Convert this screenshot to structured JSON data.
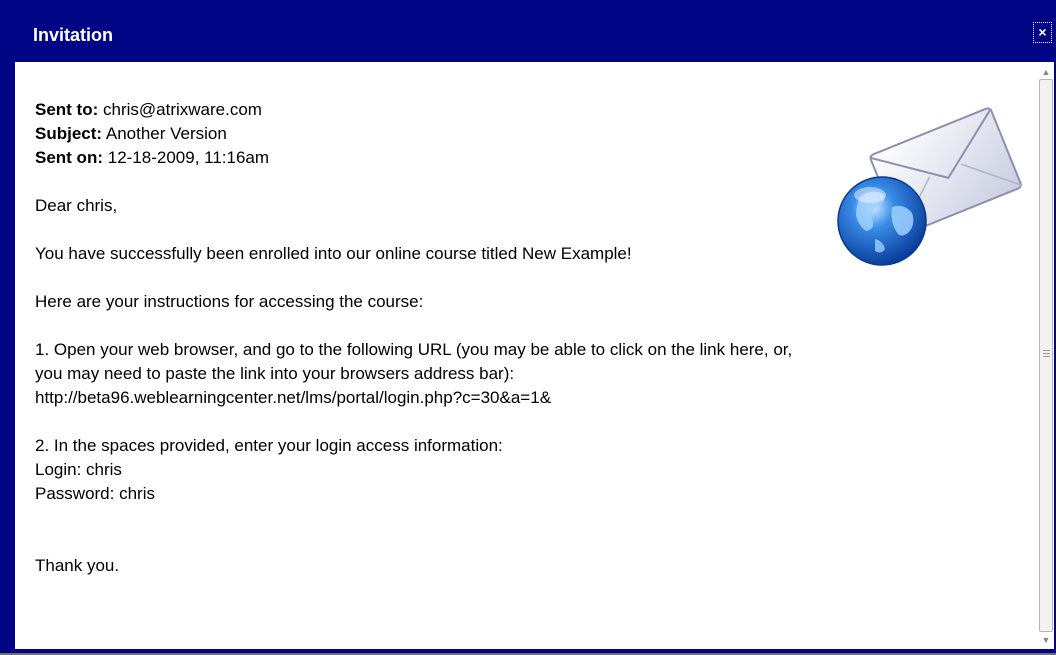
{
  "dialog": {
    "title": "Invitation",
    "close_label": "×"
  },
  "message": {
    "sent_to_label": "Sent to:",
    "sent_to": "chris@atrixware.com",
    "subject_label": "Subject:",
    "subject": "Another Version",
    "sent_on_label": "Sent on:",
    "sent_on": "12-18-2009, 11:16am",
    "greeting": "Dear chris,",
    "paragraph1": "You have successfully been enrolled into our online course titled New Example!",
    "paragraph2": "Here are your instructions for accessing the course:",
    "step1_line1": "1. Open your web browser, and go to the following URL (you may be able to click on the link here, or,",
    "step1_line2": "you may need to paste the link into your browsers address bar):",
    "url": "http://beta96.weblearningcenter.net/lms/portal/login.php?c=30&a=1&",
    "step2": "2. In the spaces provided, enter your login access information:",
    "login_line": "Login: chris",
    "password_line": "Password: chris",
    "closing": "Thank you."
  },
  "icons": {
    "email": "email-globe-icon",
    "close": "close-icon"
  },
  "colors": {
    "titlebar": "#000585",
    "content_bg": "#ffffff",
    "text": "#000000"
  }
}
